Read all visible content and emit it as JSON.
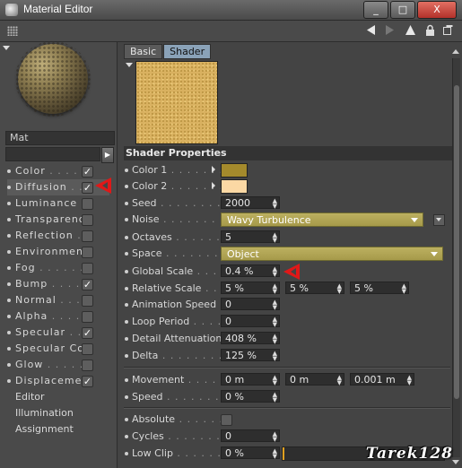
{
  "window": {
    "title": "Material Editor",
    "buttons": [
      "_",
      "□",
      "X"
    ]
  },
  "toolbar": {
    "icons": [
      "back-arrow-icon",
      "forward-arrow-icon",
      "up-arrow-icon",
      "lock-icon",
      "new-window-icon"
    ]
  },
  "material": {
    "name": "Mat"
  },
  "channels": [
    {
      "label": "Color",
      "checked": true
    },
    {
      "label": "Diffusion",
      "checked": true,
      "active": true
    },
    {
      "label": "Luminance",
      "checked": false
    },
    {
      "label": "Transparency",
      "checked": false
    },
    {
      "label": "Reflection",
      "checked": false
    },
    {
      "label": "Environment",
      "checked": false
    },
    {
      "label": "Fog",
      "checked": false
    },
    {
      "label": "Bump",
      "checked": true
    },
    {
      "label": "Normal",
      "checked": false
    },
    {
      "label": "Alpha",
      "checked": false
    },
    {
      "label": "Specular",
      "checked": true
    },
    {
      "label": "Specular Color",
      "checked": false
    },
    {
      "label": "Glow",
      "checked": false
    },
    {
      "label": "Displacement",
      "checked": true
    },
    {
      "label": "Editor"
    },
    {
      "label": "Illumination"
    },
    {
      "label": "Assignment"
    }
  ],
  "tabs": {
    "basic": "Basic",
    "shader": "Shader"
  },
  "shader": {
    "section_title": "Shader Properties",
    "color1": {
      "label": "Color 1",
      "color": "#a48a2c"
    },
    "color2": {
      "label": "Color 2",
      "color": "#fbd8a4"
    },
    "seed": {
      "label": "Seed",
      "value": "2000"
    },
    "noise": {
      "label": "Noise",
      "value": "Wavy Turbulence"
    },
    "octaves": {
      "label": "Octaves",
      "value": "5"
    },
    "space": {
      "label": "Space",
      "value": "Object"
    },
    "global_scale": {
      "label": "Global Scale",
      "value": "0.4 %"
    },
    "relative_scale": {
      "label": "Relative Scale",
      "values": [
        "5 %",
        "5 %",
        "5 %"
      ]
    },
    "animation_speed": {
      "label": "Animation Speed",
      "value": "0"
    },
    "loop_period": {
      "label": "Loop Period",
      "value": "0"
    },
    "detail_attenuation": {
      "label": "Detail Attenuation",
      "value": "408 %"
    },
    "delta": {
      "label": "Delta",
      "value": "125 %"
    },
    "movement": {
      "label": "Movement",
      "values": [
        "0 m",
        "0 m",
        "0.001 m"
      ]
    },
    "speed": {
      "label": "Speed",
      "value": "0 %"
    },
    "absolute": {
      "label": "Absolute",
      "checked": false
    },
    "cycles": {
      "label": "Cycles",
      "value": "0"
    },
    "low_clip": {
      "label": "Low Clip",
      "value": "0 %"
    }
  },
  "watermark": "Tarek128"
}
